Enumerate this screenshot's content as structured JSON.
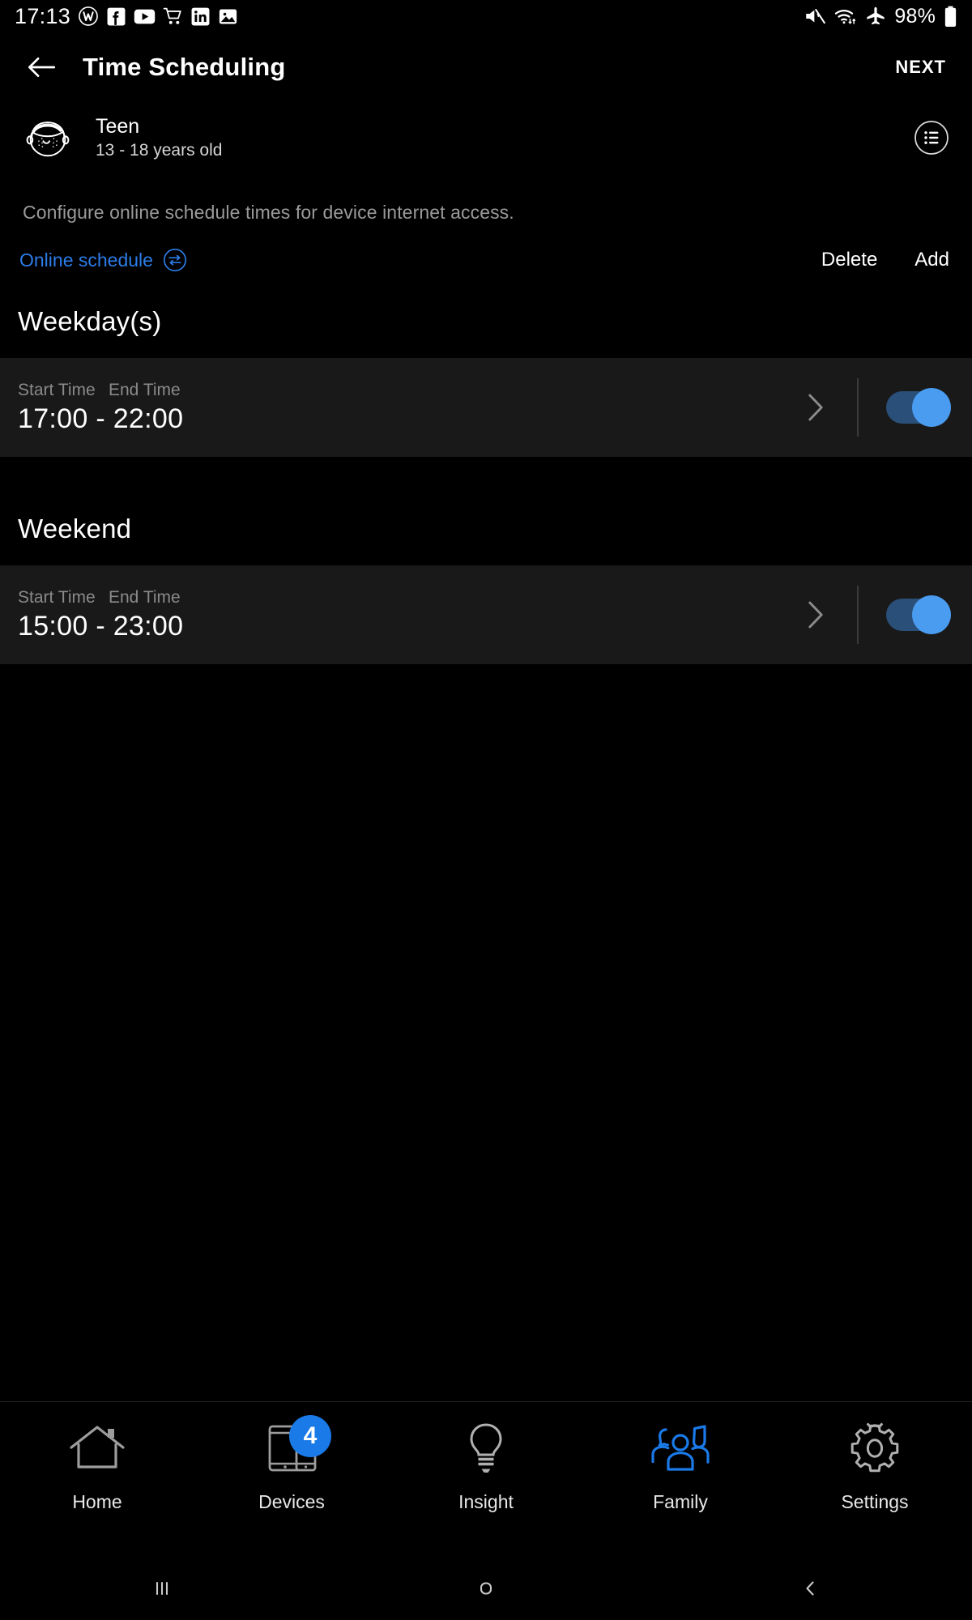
{
  "statusbar": {
    "time": "17:13",
    "left_icons": [
      "wordpress-icon",
      "facebook-icon",
      "youtube-icon",
      "shopping-cart-icon",
      "linkedin-icon",
      "photos-icon"
    ],
    "right_icons": [
      "mute-icon",
      "wifi-icon",
      "airplane-mode-icon"
    ],
    "battery_percent": "98%",
    "battery_icon": "battery-icon"
  },
  "appbar": {
    "back_icon": "back-arrow-icon",
    "title": "Time Scheduling",
    "next_label": "NEXT"
  },
  "profile": {
    "avatar_icon": "teen-face-avatar-icon",
    "name": "Teen",
    "age_range": "13 - 18 years old",
    "list_icon": "list-circle-icon"
  },
  "description": "Configure online schedule times for device internet access.",
  "schedule_bar": {
    "link_label": "Online schedule",
    "link_icon": "swap-arrows-circle-icon",
    "link_color": "#2c7ce8",
    "delete_label": "Delete",
    "add_label": "Add"
  },
  "sections": [
    {
      "title": "Weekday(s)",
      "start_label": "Start Time",
      "end_label": "End Time",
      "time_range": "17:00 - 22:00",
      "chevron_icon": "chevron-right-icon",
      "toggle_on": true
    },
    {
      "title": "Weekend",
      "start_label": "Start Time",
      "end_label": "End Time",
      "time_range": "15:00 - 23:00",
      "chevron_icon": "chevron-right-icon",
      "toggle_on": true
    }
  ],
  "bottomnav": {
    "active_color": "#1a7ae8",
    "items": [
      {
        "label": "Home",
        "icon": "home-icon",
        "active": false,
        "badge": null
      },
      {
        "label": "Devices",
        "icon": "devices-icon",
        "active": false,
        "badge": "4"
      },
      {
        "label": "Insight",
        "icon": "bulb-icon",
        "active": false,
        "badge": null
      },
      {
        "label": "Family",
        "icon": "family-icon",
        "active": true,
        "badge": null
      },
      {
        "label": "Settings",
        "icon": "gear-icon",
        "active": false,
        "badge": null
      }
    ]
  },
  "sysnav": {
    "recents_icon": "recent-apps-icon",
    "home_icon": "home-circle-icon",
    "back_icon": "system-back-icon"
  }
}
